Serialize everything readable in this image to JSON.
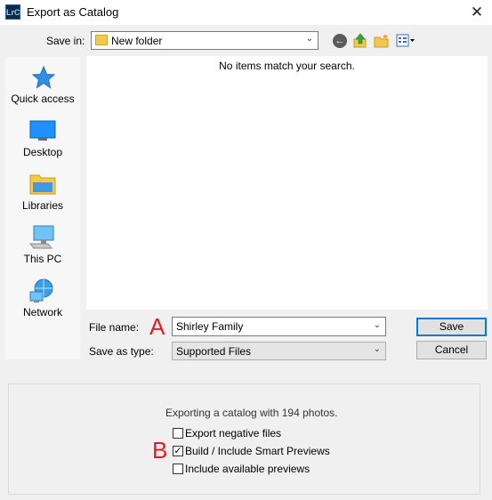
{
  "window": {
    "app_icon_text": "LrC",
    "title": "Export as Catalog",
    "close_glyph": "✕"
  },
  "save_in": {
    "label": "Save in:",
    "value": "New folder"
  },
  "toolbar": {
    "icons": [
      "back-icon",
      "up-folder-icon",
      "new-folder-icon",
      "view-menu-icon"
    ]
  },
  "sidebar": {
    "items": [
      {
        "label": "Quick access",
        "icon": "star-icon"
      },
      {
        "label": "Desktop",
        "icon": "desktop-icon"
      },
      {
        "label": "Libraries",
        "icon": "libraries-icon"
      },
      {
        "label": "This PC",
        "icon": "computer-icon"
      },
      {
        "label": "Network",
        "icon": "network-icon"
      }
    ]
  },
  "file_list": {
    "empty_message": "No items match your search."
  },
  "file_name": {
    "label": "File name:",
    "value": "Shirley Family"
  },
  "save_as_type": {
    "label": "Save as type:",
    "value": "Supported Files"
  },
  "buttons": {
    "save": "Save",
    "cancel": "Cancel"
  },
  "annotations": {
    "a": "A",
    "b": "B",
    "color": "#e31b23"
  },
  "options": {
    "info": "Exporting a catalog with 194 photos.",
    "checkboxes": [
      {
        "label": "Export negative files",
        "checked": false
      },
      {
        "label": "Build / Include Smart Previews",
        "checked": true
      },
      {
        "label": "Include available previews",
        "checked": false
      }
    ]
  },
  "colors": {
    "accent": "#0078d7",
    "folder": "#f3c94c"
  }
}
